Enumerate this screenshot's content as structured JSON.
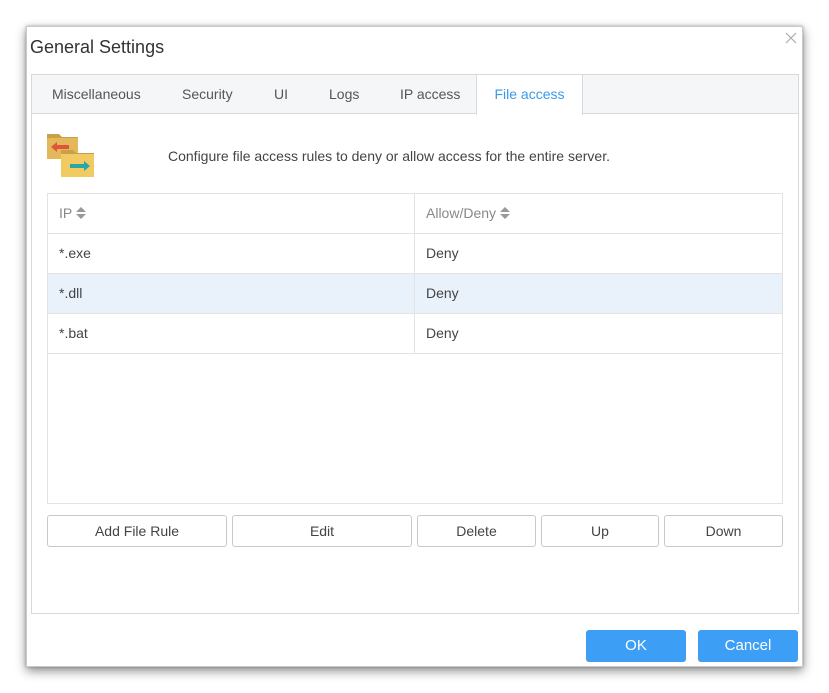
{
  "dialog": {
    "title": "General Settings",
    "close_icon": "close-icon"
  },
  "tabs": [
    {
      "label": "Miscellaneous",
      "active": false
    },
    {
      "label": "Security",
      "active": false
    },
    {
      "label": "UI",
      "active": false
    },
    {
      "label": "Logs",
      "active": false
    },
    {
      "label": "IP access",
      "active": false
    },
    {
      "label": "File access",
      "active": true
    }
  ],
  "section": {
    "icon": "folder-transfer-icon",
    "description": "Configure file access rules to deny or allow access for the entire server."
  },
  "table": {
    "columns": [
      "IP",
      "Allow/Deny"
    ],
    "rows": [
      {
        "ip": "*.exe",
        "rule": "Deny",
        "selected": false
      },
      {
        "ip": "*.dll",
        "rule": "Deny",
        "selected": true
      },
      {
        "ip": "*.bat",
        "rule": "Deny",
        "selected": false
      }
    ]
  },
  "actions": {
    "add": "Add File Rule",
    "edit": "Edit",
    "delete": "Delete",
    "up": "Up",
    "down": "Down"
  },
  "footer": {
    "ok": "OK",
    "cancel": "Cancel"
  },
  "colors": {
    "accent": "#3a9ae8",
    "primary_button": "#3d9ef5",
    "selected_row": "#e9f1fb"
  }
}
